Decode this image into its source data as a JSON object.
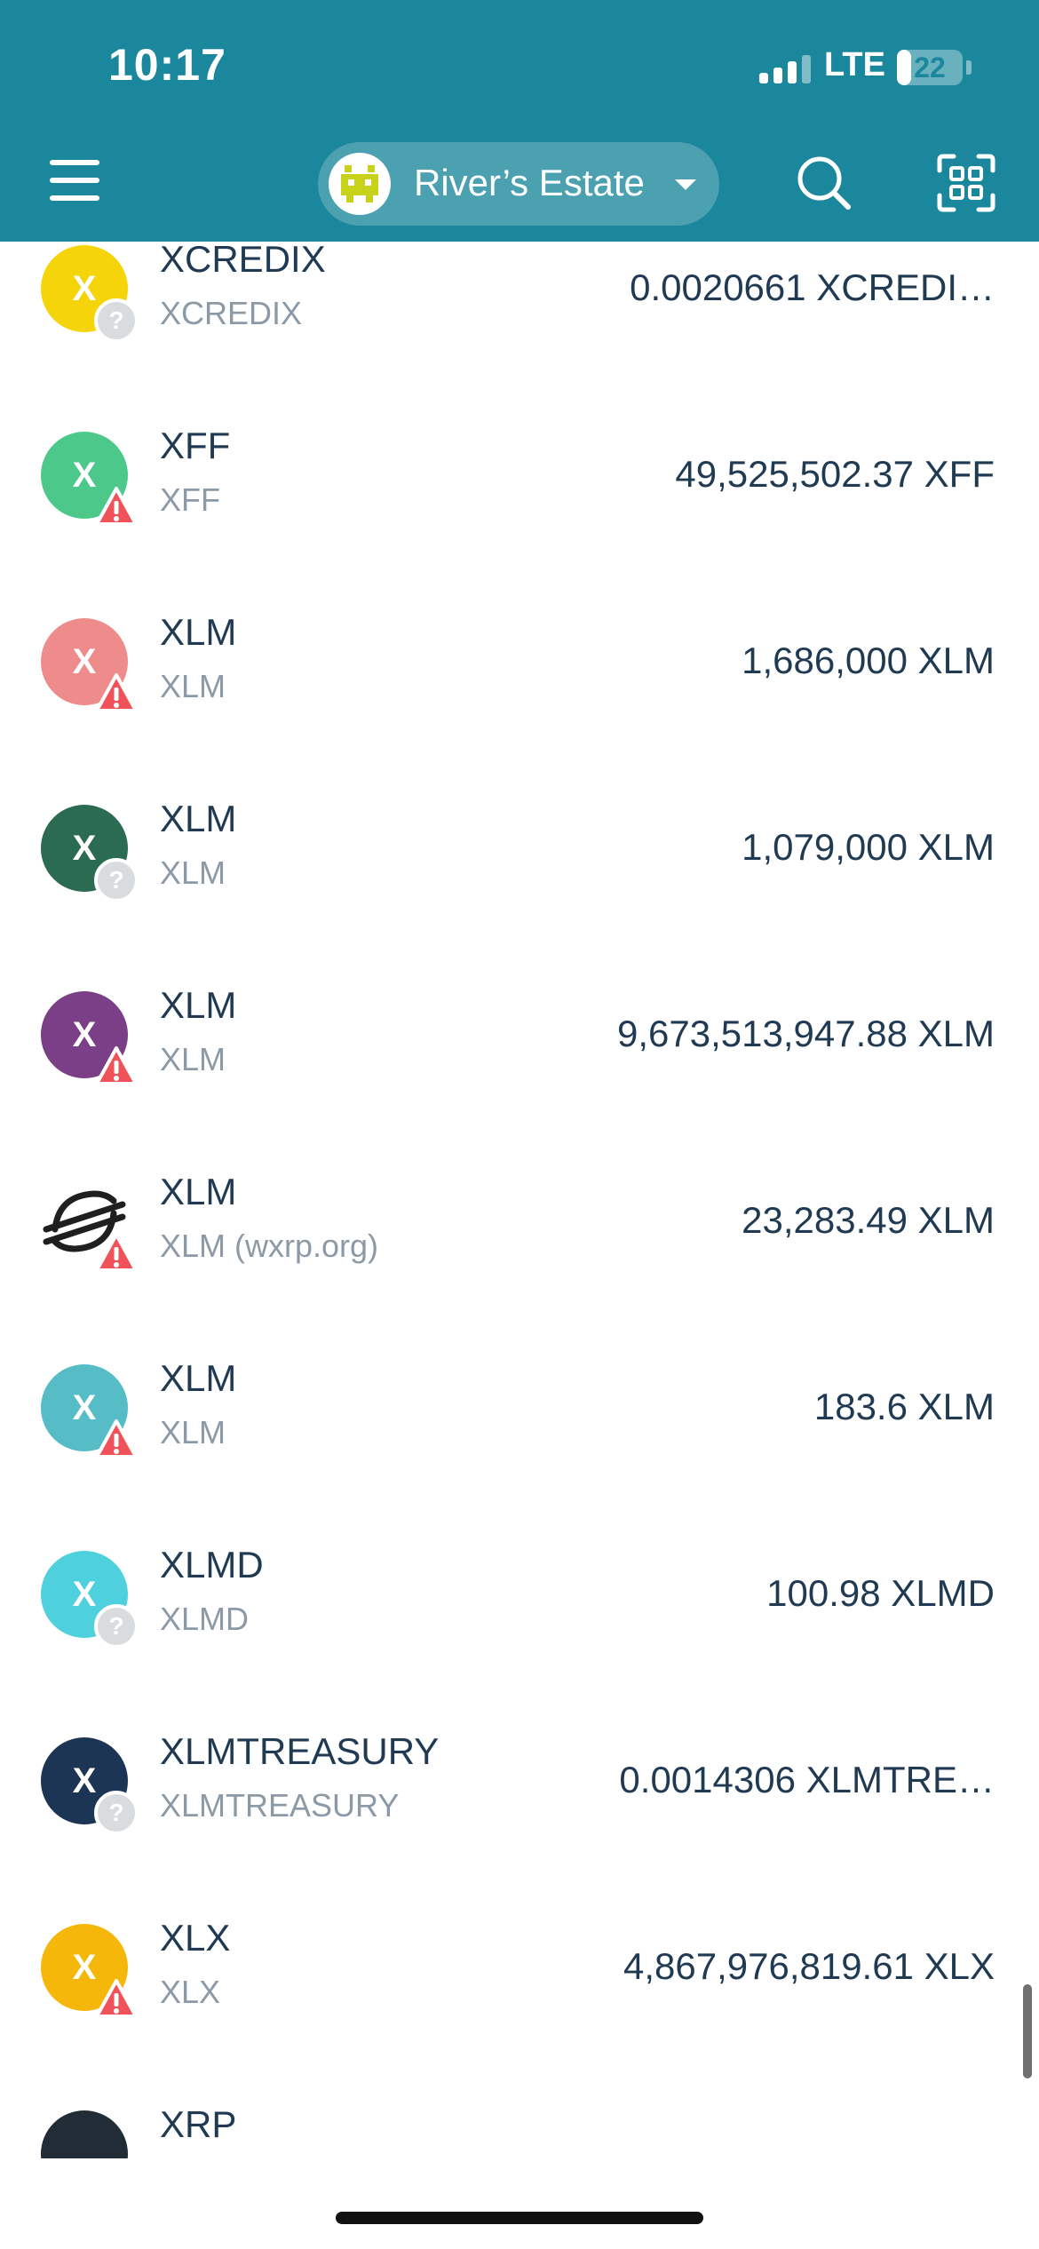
{
  "status_bar": {
    "time": "10:17",
    "network": "LTE",
    "battery_level": "22",
    "battery_fraction": 0.22,
    "signal_bars_active": 3,
    "signal_bars_total": 4
  },
  "header": {
    "wallet_name": "River’s Estate",
    "menu_icon": "hamburger-menu-icon",
    "search_icon": "search-icon",
    "scan_icon": "qr-scan-icon",
    "background_color": "#1a879c"
  },
  "badge_types": {
    "unknown": "question-icon",
    "warning": "warning-icon"
  },
  "tokens": [
    {
      "name": "XCREDIX",
      "subtitle": "XCREDIX",
      "balance": "0.0020661 XCREDI…",
      "icon_letter": "X",
      "icon_color": "#f5d50a",
      "badge": "unknown"
    },
    {
      "name": "XFF",
      "subtitle": "XFF",
      "balance": "49,525,502.37 XFF",
      "icon_letter": "X",
      "icon_color": "#4cc98a",
      "badge": "warning"
    },
    {
      "name": "XLM",
      "subtitle": "XLM",
      "balance": "1,686,000 XLM",
      "icon_letter": "X",
      "icon_color": "#ee8b8b",
      "badge": "warning"
    },
    {
      "name": "XLM",
      "subtitle": "XLM",
      "balance": "1,079,000 XLM",
      "icon_letter": "X",
      "icon_color": "#2a6b52",
      "badge": "unknown"
    },
    {
      "name": "XLM",
      "subtitle": "XLM",
      "balance": "9,673,513,947.88 XLM",
      "icon_letter": "X",
      "icon_color": "#7a3f86",
      "badge": "warning"
    },
    {
      "name": "XLM",
      "subtitle": "XLM (wxrp.org)",
      "balance": "23,283.49 XLM",
      "icon_letter": "",
      "icon_color": "#1f1f1f",
      "icon_type": "stellar-logo-icon",
      "badge": "warning"
    },
    {
      "name": "XLM",
      "subtitle": "XLM",
      "balance": "183.6 XLM",
      "icon_letter": "X",
      "icon_color": "#56bcc6",
      "badge": "warning"
    },
    {
      "name": "XLMD",
      "subtitle": "XLMD",
      "balance": "100.98 XLMD",
      "icon_letter": "X",
      "icon_color": "#4ed0dd",
      "badge": "unknown"
    },
    {
      "name": "XLMTREASURY",
      "subtitle": "XLMTREASURY",
      "balance": "0.0014306 XLMTRE…",
      "icon_letter": "X",
      "icon_color": "#1d3554",
      "badge": "unknown"
    },
    {
      "name": "XLX",
      "subtitle": "XLX",
      "balance": "4,867,976,819.61 XLX",
      "icon_letter": "X",
      "icon_color": "#f5b80a",
      "badge": "warning"
    },
    {
      "name": "XRP",
      "subtitle": "",
      "balance": "",
      "icon_letter": "",
      "icon_color": "#222c36",
      "badge": "none"
    }
  ]
}
